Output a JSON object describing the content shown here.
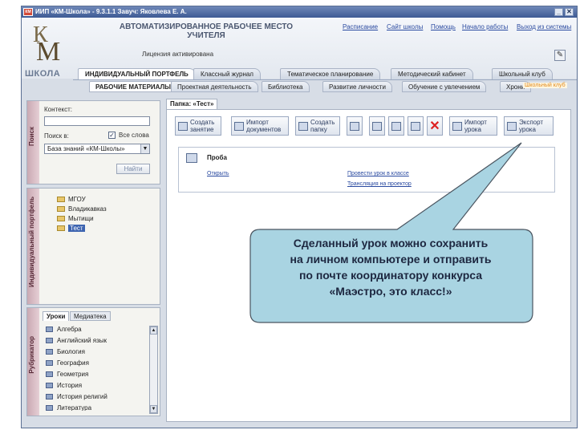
{
  "window": {
    "title": "ИИП «КМ-Школа» - 9.3.1.1 Завуч: Яковлева Е. А.",
    "title_icon": "КМ",
    "minimize": "_",
    "close": "✕"
  },
  "header": {
    "logo_letters": [
      "К",
      "М"
    ],
    "logo_text": "ШКОЛА",
    "app_title_line1": "АВТОМАТИЗИРОВАННОЕ РАБОЧЕЕ МЕСТО",
    "app_title_line2": "УЧИТЕЛЯ",
    "license": "Лицензия активирована",
    "links": [
      "Расписание",
      "Сайт школы",
      "Помощь",
      "Начало работы",
      "Выход из системы"
    ]
  },
  "main_tabs": [
    "ИНДИВИДУАЛЬНЫЙ ПОРТФЕЛЬ",
    "Классный журнал",
    "Тематическое планирование",
    "Методический кабинет",
    "Школьный клуб"
  ],
  "sub_tabs": [
    "РАБОЧИЕ МАТЕРИАЛЫ",
    "Проектная деятельность",
    "Библиотека",
    "Развитие личности",
    "Обучение с увлечением",
    "Хрони"
  ],
  "school_club_badge": "Школьный клуб",
  "search_panel": {
    "side_label": "Поиск",
    "context_label": "Контекст:",
    "context_value": "",
    "search_in_label": "Поиск в:",
    "all_words_label": "Все слова",
    "all_words_checked": true,
    "database": "База знаний «КМ-Школы»",
    "find_button": "Найти"
  },
  "portfolio_panel": {
    "side_label": "Индивидуальный портфель",
    "folders": [
      "МГОУ",
      "Владикавказ",
      "Мытищи",
      "Тест"
    ],
    "selected": "Тест"
  },
  "rubricator_panel": {
    "side_label": "Рубрикатор",
    "tabs": [
      "Уроки",
      "Медиатека"
    ],
    "items": [
      "Алгебра",
      "Английский язык",
      "Биология",
      "География",
      "Геометрия",
      "История",
      "История религий",
      "Литература"
    ]
  },
  "folder_tab": "Папка: «Тест»",
  "toolbar": {
    "create_lesson": [
      "Создать",
      "занятие"
    ],
    "import_docs": [
      "Импорт",
      "документов"
    ],
    "create_folder": [
      "Создать",
      "папку"
    ],
    "import_lesson": [
      "Импорт",
      "урока"
    ],
    "export_lesson": [
      "Экспорт",
      "урока"
    ],
    "delete": "✕"
  },
  "lesson": {
    "title": "Проба",
    "open_link": "Открыть",
    "conduct_link": "Провести урок в классе",
    "projector_link": "Трансляция на проектор"
  },
  "callout": {
    "lines": [
      "Сделанный урок можно сохранить",
      "на личном компьютере и отправить",
      "по почте координатору конкурса",
      "«Маэстро, это класс!»"
    ],
    "fill": "#a9d4e2"
  }
}
